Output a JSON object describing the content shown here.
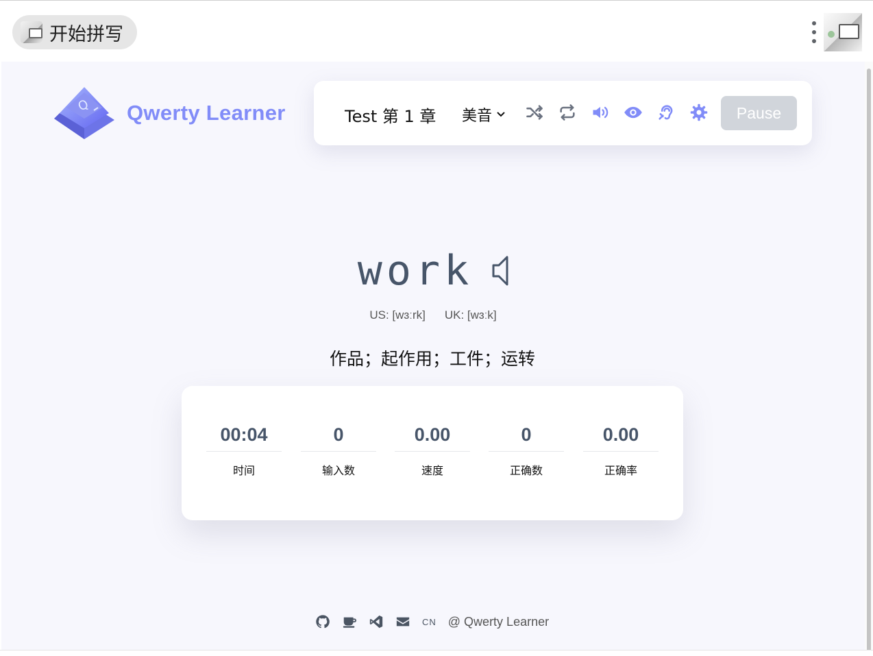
{
  "window": {
    "mini_title": "开始拼写"
  },
  "brand": {
    "name": "Qwerty Learner",
    "color": "#818cf8"
  },
  "toolbar": {
    "chapter": "Test 第 1 章",
    "pronunciation": "美音",
    "pause_label": "Pause",
    "icons": [
      "shuffle-icon",
      "loop-icon",
      "volume-icon",
      "eye-icon",
      "hearing-icon",
      "settings-icon"
    ]
  },
  "word": {
    "text": "work",
    "us_phonetic": "US: [wɜːrk]",
    "uk_phonetic": "UK: [wɜːk]",
    "translation": "作品；起作用；工件；运转"
  },
  "stats": [
    {
      "value": "00:04",
      "label": "时间"
    },
    {
      "value": "0",
      "label": "输入数"
    },
    {
      "value": "0.00",
      "label": "速度"
    },
    {
      "value": "0",
      "label": "正确数"
    },
    {
      "value": "0.00",
      "label": "正确率"
    }
  ],
  "footer": {
    "lang": "CN",
    "credit": "@ Qwerty Learner"
  }
}
